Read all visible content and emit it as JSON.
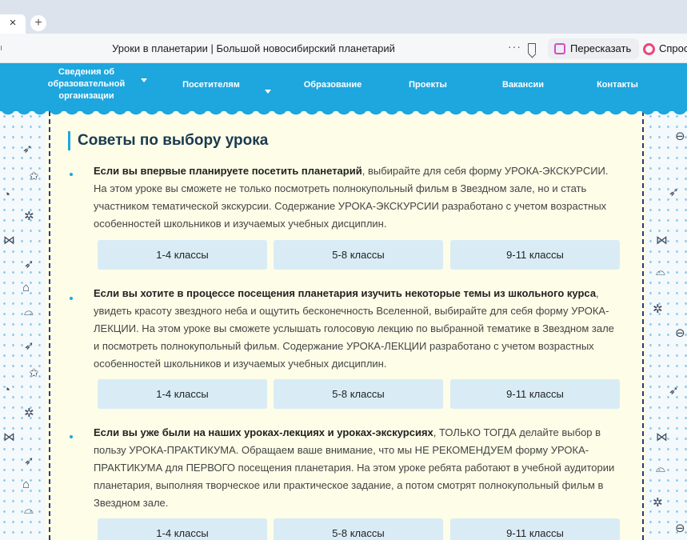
{
  "browser": {
    "tab_close": "×",
    "new_tab": "+",
    "page_title": "Уроки в планетарии | Большой новосибирский планетарий",
    "more": "···",
    "retell_label": "Пересказать",
    "ask_label": "Спрос"
  },
  "nav": {
    "items": [
      {
        "line1": "Сведения об",
        "line2": "образовательной",
        "line3": "организации"
      },
      {
        "label": "Посетителям"
      },
      {
        "label": "Образование"
      },
      {
        "label": "Проекты"
      },
      {
        "label": "Вакансии"
      },
      {
        "label": "Контакты"
      }
    ]
  },
  "content": {
    "heading": "Советы по выбору урока",
    "blocks": [
      {
        "bold": "Если вы впервые планируете посетить планетарий",
        "text": ", выбирайте для себя форму УРОКА-ЭКСКУРСИИ. На этом уроке вы сможете не только посмотреть полнокупольный фильм в Звездном зале, но и стать участником тематической экскурсии. Содержание УРОКА-ЭКСКУРСИИ разработано с учетом возрастных особенностей школьников и изучаемых учебных дисциплин.",
        "buttons": [
          "1-4 классы",
          "5-8 классы",
          "9-11 классы"
        ]
      },
      {
        "bold": "Если вы хотите в процессе посещения планетария изучить некоторые темы из школьного курса",
        "text": ", увидеть красоту звездного неба и ощутить бесконечность Вселенной, выбирайте для себя форму УРОКА-ЛЕКЦИИ. На этом уроке вы сможете услышать голосовую лекцию по выбранной тематике в Звездном зале и посмотреть полнокупольный фильм. Содержание УРОКА-ЛЕКЦИИ разработано с учетом возрастных особенностей школьников и изучаемых учебных дисциплин.",
        "buttons": [
          "1-4 классы",
          "5-8 классы",
          "9-11 классы"
        ]
      },
      {
        "bold": "Если вы уже были на наших уроках-лекциях и уроках-экскурсиях",
        "text": ", ТОЛЬКО ТОГДА делайте выбор в пользу УРОКА-ПРАКТИКУМА. Обращаем ваше внимание, что мы НЕ РЕКОМЕНДУЕМ форму УРОКА-ПРАКТИКУМА для ПЕРВОГО посещения планетария. На этом уроке ребята работают в учебной аудитории планетария, выполняя творческое или практическое задание, а потом смотрят полнокупольный фильм в Звездном зале.",
        "buttons": [
          "1-4 классы",
          "5-8 классы",
          "9-11 классы"
        ]
      }
    ]
  },
  "colors": {
    "nav_blue": "#1ea6de",
    "content_bg": "#fdfde8",
    "button_bg": "#d9ecf6",
    "heading": "#1a3a50"
  }
}
